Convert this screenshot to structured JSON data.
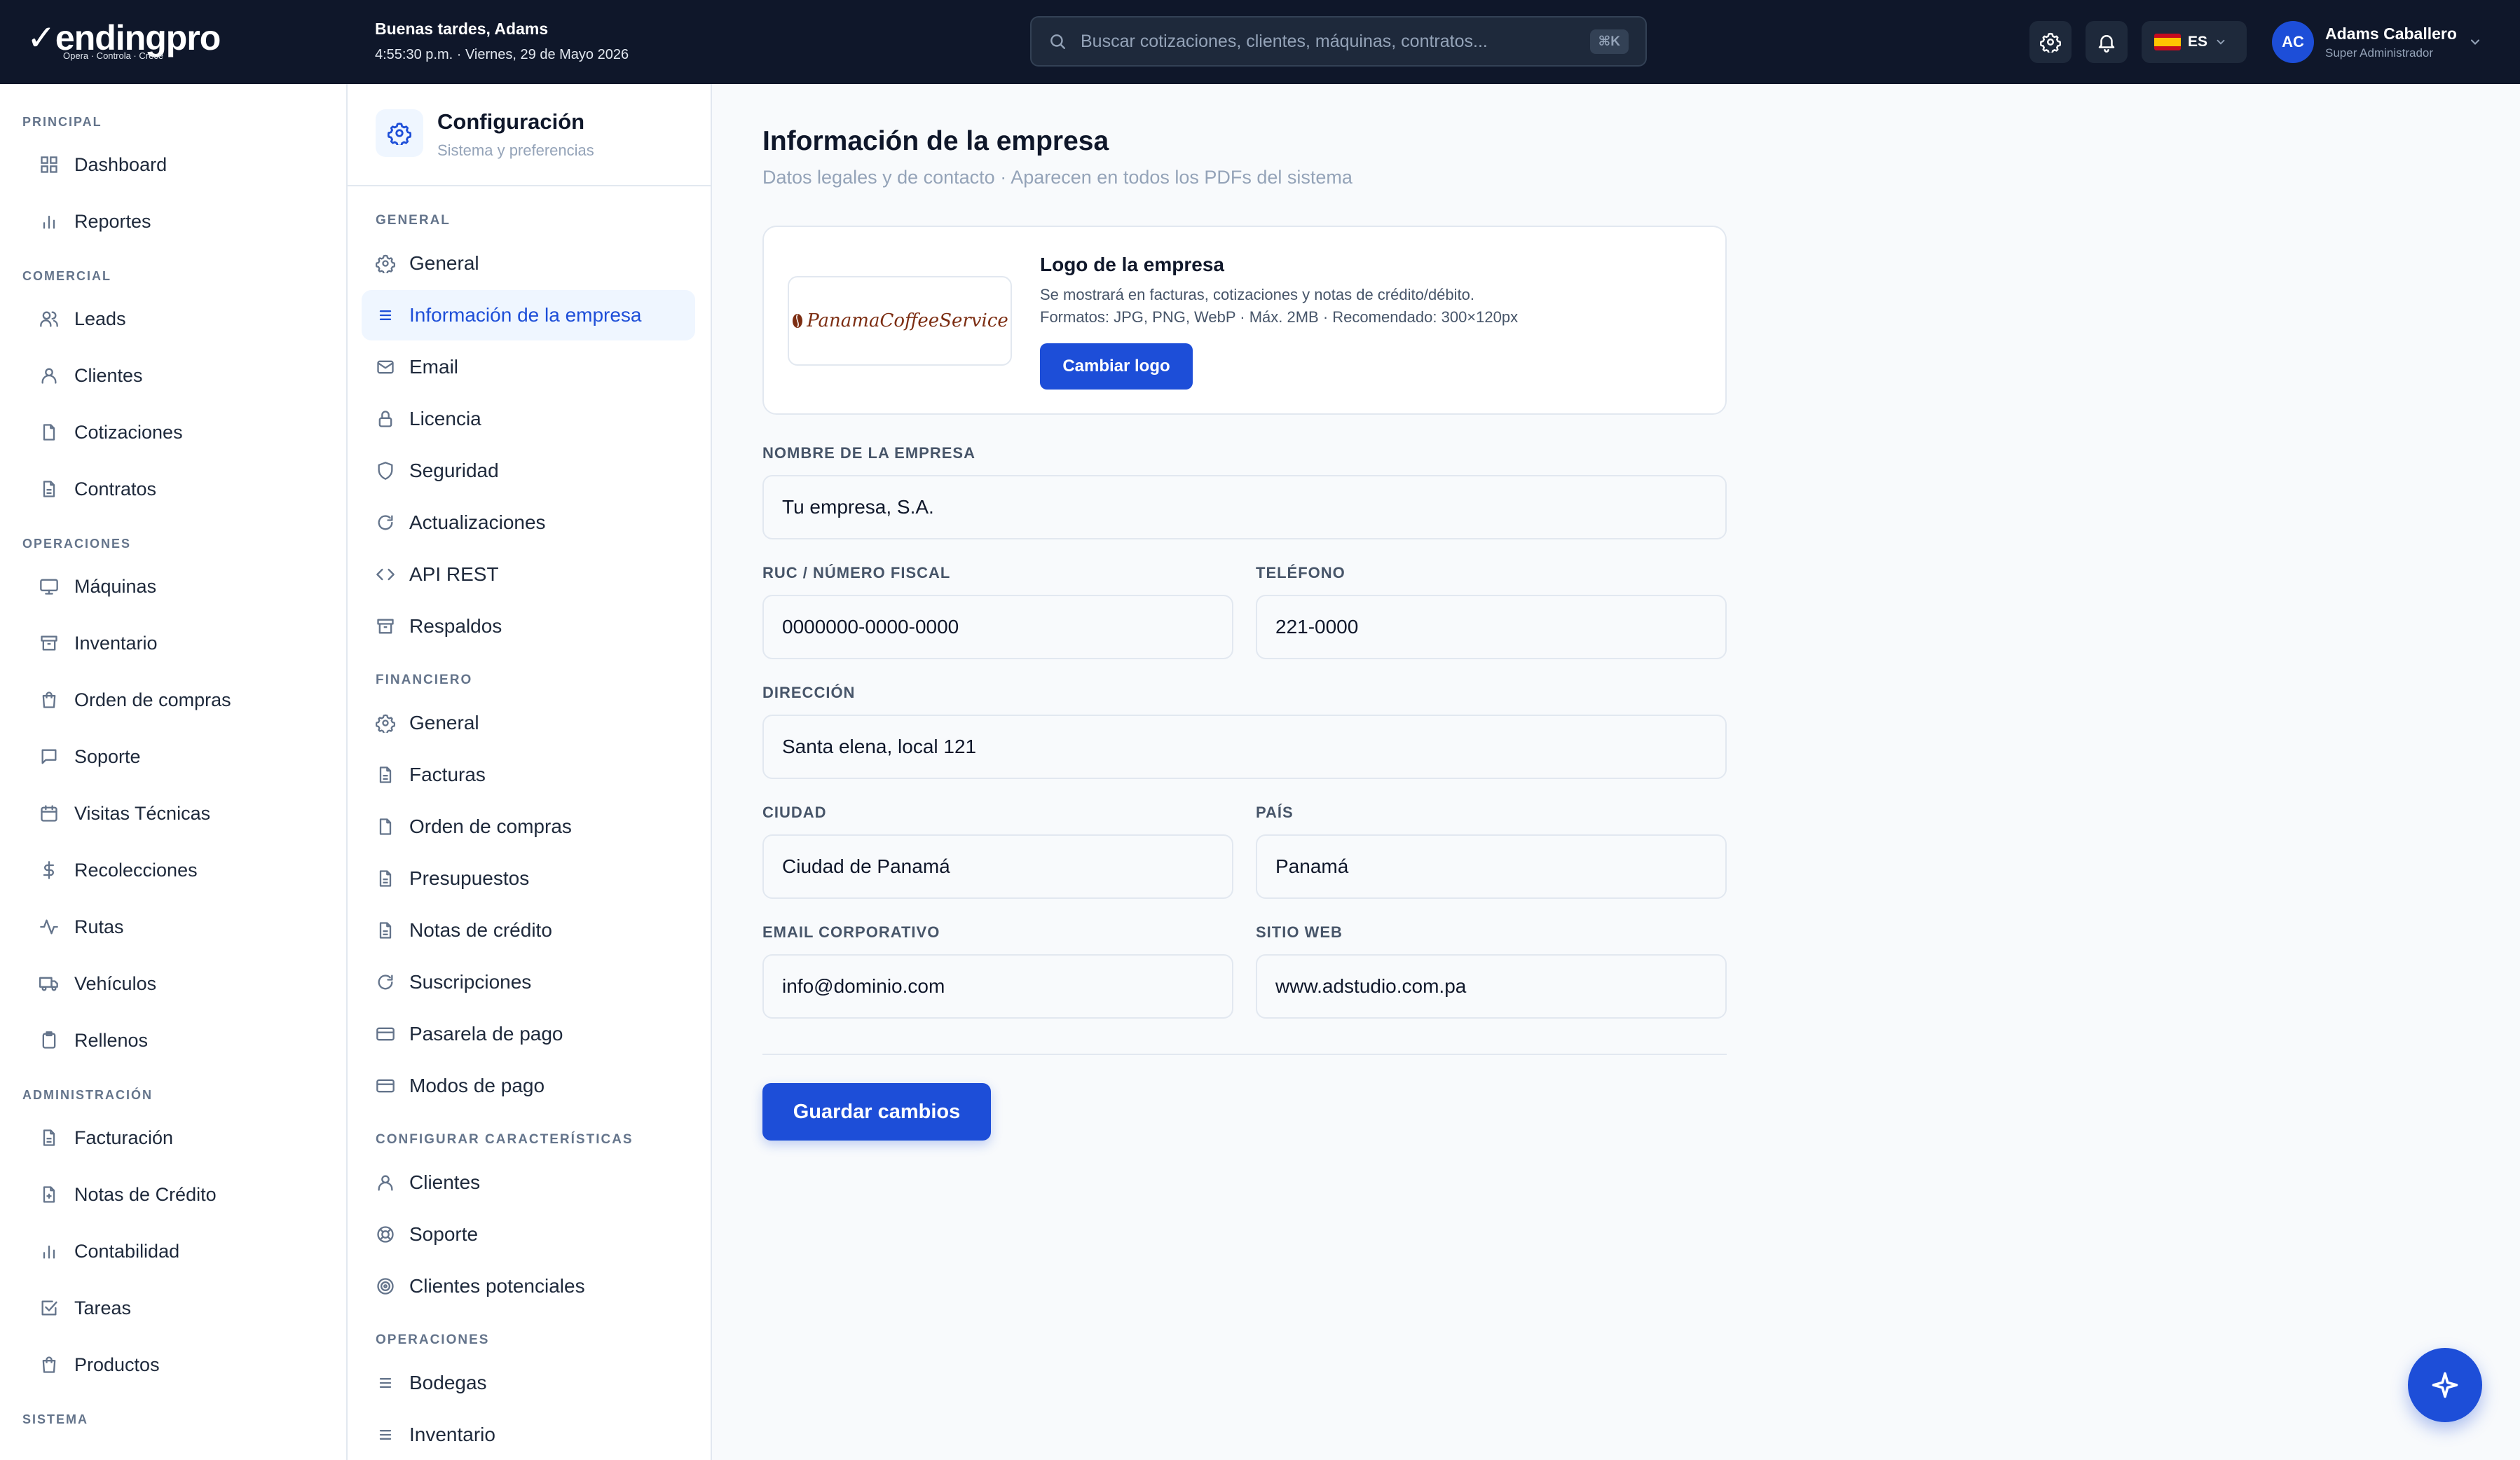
{
  "brand": {
    "name": "endingpro",
    "tagline": "Opera · Controla · Crece"
  },
  "greeting": {
    "title": "Buenas tardes, Adams",
    "datetime": "4:55:30 p.m. · Viernes, 29 de Mayo 2026"
  },
  "search": {
    "placeholder": "Buscar cotizaciones, clientes, máquinas, contratos...",
    "shortcut": "⌘K"
  },
  "language": {
    "code": "ES",
    "flag": "spain-flag"
  },
  "user": {
    "initials": "AC",
    "name": "Adams Caballero",
    "role": "Super Administrador"
  },
  "sidebar": {
    "sections": [
      "PRINCIPAL",
      "COMERCIAL",
      "OPERACIONES",
      "ADMINISTRACIÓN",
      "SISTEMA"
    ],
    "items": [
      {
        "label": "Dashboard",
        "icon": "grid-icon"
      },
      {
        "label": "Reportes",
        "icon": "bar-chart-icon"
      },
      {
        "label": "Leads",
        "icon": "users-icon"
      },
      {
        "label": "Clientes",
        "icon": "user-icon"
      },
      {
        "label": "Cotizaciones",
        "icon": "file-icon"
      },
      {
        "label": "Contratos",
        "icon": "file-text-icon"
      },
      {
        "label": "Máquinas",
        "icon": "monitor-icon"
      },
      {
        "label": "Inventario",
        "icon": "archive-icon"
      },
      {
        "label": "Orden de compras",
        "icon": "shopping-bag-icon"
      },
      {
        "label": "Soporte",
        "icon": "message-icon"
      },
      {
        "label": "Visitas Técnicas",
        "icon": "calendar-icon"
      },
      {
        "label": "Recolecciones",
        "icon": "dollar-icon"
      },
      {
        "label": "Rutas",
        "icon": "activity-icon"
      },
      {
        "label": "Vehículos",
        "icon": "truck-icon"
      },
      {
        "label": "Rellenos",
        "icon": "clipboard-icon"
      },
      {
        "label": "Facturación",
        "icon": "file-text-icon"
      },
      {
        "label": "Notas de Crédito",
        "icon": "file-plus-icon"
      },
      {
        "label": "Contabilidad",
        "icon": "bar-chart-icon"
      },
      {
        "label": "Tareas",
        "icon": "check-square-icon"
      },
      {
        "label": "Productos",
        "icon": "shopping-bag-icon"
      }
    ]
  },
  "config": {
    "title": "Configuración",
    "subtitle": "Sistema y preferencias",
    "sections": [
      "GENERAL",
      "FINANCIERO",
      "CONFIGURAR CARACTERÍSTICAS",
      "OPERACIONES"
    ],
    "items": [
      {
        "label": "General",
        "icon": "gear-icon"
      },
      {
        "label": "Información de la empresa",
        "icon": "list-icon"
      },
      {
        "label": "Email",
        "icon": "mail-icon"
      },
      {
        "label": "Licencia",
        "icon": "lock-icon"
      },
      {
        "label": "Seguridad",
        "icon": "shield-icon"
      },
      {
        "label": "Actualizaciones",
        "icon": "refresh-icon"
      },
      {
        "label": "API REST",
        "icon": "code-icon"
      },
      {
        "label": "Respaldos",
        "icon": "archive-icon"
      },
      {
        "label": "General",
        "icon": "gear-icon"
      },
      {
        "label": "Facturas",
        "icon": "file-text-icon"
      },
      {
        "label": "Orden de compras",
        "icon": "file-icon"
      },
      {
        "label": "Presupuestos",
        "icon": "file-text-icon"
      },
      {
        "label": "Notas de crédito",
        "icon": "file-text-icon"
      },
      {
        "label": "Suscripciones",
        "icon": "refresh-icon"
      },
      {
        "label": "Pasarela de pago",
        "icon": "credit-card-icon"
      },
      {
        "label": "Modos de pago",
        "icon": "credit-card-icon"
      },
      {
        "label": "Clientes",
        "icon": "user-icon"
      },
      {
        "label": "Soporte",
        "icon": "lifebuoy-icon"
      },
      {
        "label": "Clientes potenciales",
        "icon": "target-icon"
      },
      {
        "label": "Bodegas",
        "icon": "list-icon"
      },
      {
        "label": "Inventario",
        "icon": "list-icon"
      }
    ],
    "active": "Información de la empresa"
  },
  "page": {
    "title": "Información de la empresa",
    "subtitle": "Datos legales y de contacto · Aparecen en todos los PDFs del sistema"
  },
  "logo": {
    "title": "Logo de la empresa",
    "description": "Se mostrará en facturas, cotizaciones y notas de crédito/débito.",
    "formats": "Formatos: JPG, PNG, WebP · Máx. 2MB · Recomendado: 300×120px",
    "button": "Cambiar logo",
    "image_text": "PanamaCoffeeService"
  },
  "form": {
    "company_name": {
      "label": "NOMBRE DE LA EMPRESA",
      "value": "Tu empresa, S.A."
    },
    "ruc": {
      "label": "RUC / NÚMERO FISCAL",
      "value": "0000000-0000-0000"
    },
    "phone": {
      "label": "TELÉFONO",
      "value": "221-0000"
    },
    "address": {
      "label": "DIRECCIÓN",
      "value": "Santa elena, local 121"
    },
    "city": {
      "label": "CIUDAD",
      "value": "Ciudad de Panamá"
    },
    "country": {
      "label": "PAÍS",
      "value": "Panamá"
    },
    "email": {
      "label": "EMAIL CORPORATIVO",
      "value": "info@dominio.com"
    },
    "website": {
      "label": "SITIO WEB",
      "value": "www.adstudio.com.pa"
    }
  },
  "save_button": "Guardar cambios",
  "colors": {
    "accent": "#1d4ed8",
    "topbar": "#0f172a",
    "active_bg": "#eff6ff"
  }
}
